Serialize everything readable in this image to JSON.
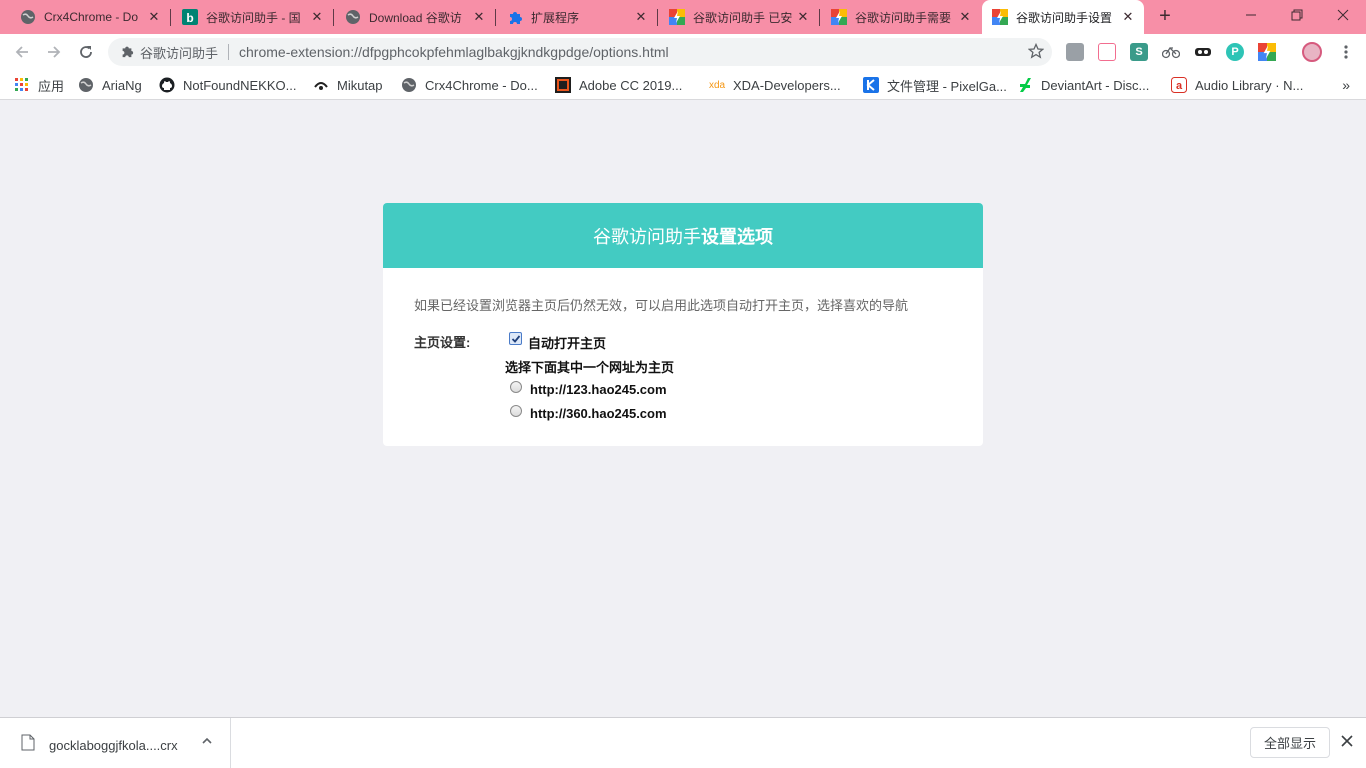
{
  "tabs": [
    {
      "title": "Crx4Chrome - Do",
      "icon": "globe-icon"
    },
    {
      "title": "谷歌访问助手 - 国",
      "icon": "bing-icon"
    },
    {
      "title": "Download 谷歌访",
      "icon": "globe-icon"
    },
    {
      "title": "扩展程序",
      "icon": "puzzle-icon"
    },
    {
      "title": "谷歌访问助手 已安",
      "icon": "helper-icon"
    },
    {
      "title": "谷歌访问助手需要",
      "icon": "helper-icon"
    },
    {
      "title": "谷歌访问助手设置",
      "icon": "helper-icon",
      "active": true
    }
  ],
  "omnibox": {
    "extension_name": "谷歌访问助手",
    "url": "chrome-extension://dfpgphcokpfehmlaglbakgjkndkgpdge/options.html"
  },
  "bookmarks": [
    {
      "label": "应用",
      "icon": "apps-icon"
    },
    {
      "label": "AriaNg",
      "icon": "globe-icon"
    },
    {
      "label": "NotFoundNEKKO...",
      "icon": "github-icon"
    },
    {
      "label": "Mikutap",
      "icon": "mikutap-icon"
    },
    {
      "label": "Crx4Chrome - Do...",
      "icon": "globe-icon"
    },
    {
      "label": "Adobe CC 2019...",
      "icon": "adobe-icon"
    },
    {
      "label": "XDA-Developers...",
      "icon": "xda-icon"
    },
    {
      "label": "文件管理 - PixelGa...",
      "icon": "k-icon"
    },
    {
      "label": "DeviantArt - Disc...",
      "icon": "deviantart-icon"
    },
    {
      "label": "Audio Library · N...",
      "icon": "audio-library-icon"
    }
  ],
  "options": {
    "title_normal": "谷歌访问助手",
    "title_bold": "设置选项",
    "description": "如果已经设置浏览器主页后仍然无效，可以启用此选项自动打开主页，选择喜欢的导航",
    "homepage_label": "主页设置:",
    "auto_open_label": "自动打开主页",
    "auto_open_checked": true,
    "choose_label": "选择下面其中一个网址为主页",
    "homepage_options": [
      "http://123.hao245.com",
      "http://360.hao245.com"
    ]
  },
  "downloads": {
    "filename": "gocklaboggjfkola....crx",
    "show_all": "全部显示"
  },
  "colors": {
    "tabstrip": "#f78fa7",
    "card_header": "#43cbc2",
    "page_bg": "#f0f0f4"
  }
}
